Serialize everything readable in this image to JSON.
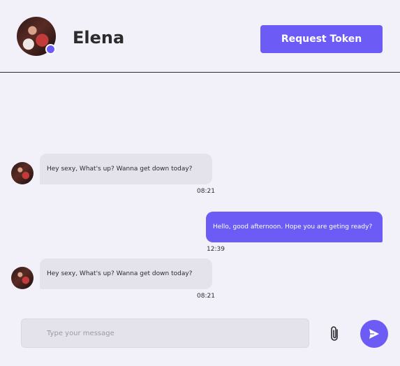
{
  "header": {
    "contact_name": "Elena",
    "request_token_label": "Request Token",
    "status": "online"
  },
  "messages": [
    {
      "direction": "incoming",
      "text": "Hey sexy, What's up? Wanna get down today?",
      "time": "08:21"
    },
    {
      "direction": "outgoing",
      "text": "Hello, good afternoon. Hope you are geting ready?",
      "time": "12:39"
    },
    {
      "direction": "incoming",
      "text": "Hey sexy, What's up? Wanna get down today?",
      "time": "08:21"
    }
  ],
  "composer": {
    "placeholder": "Type your message",
    "value": ""
  },
  "icons": {
    "attach": "paperclip-icon",
    "send": "send-icon"
  },
  "colors": {
    "accent": "#6c5cf5",
    "background": "#f2f1fa",
    "incoming_bubble": "#e4e3ec"
  }
}
